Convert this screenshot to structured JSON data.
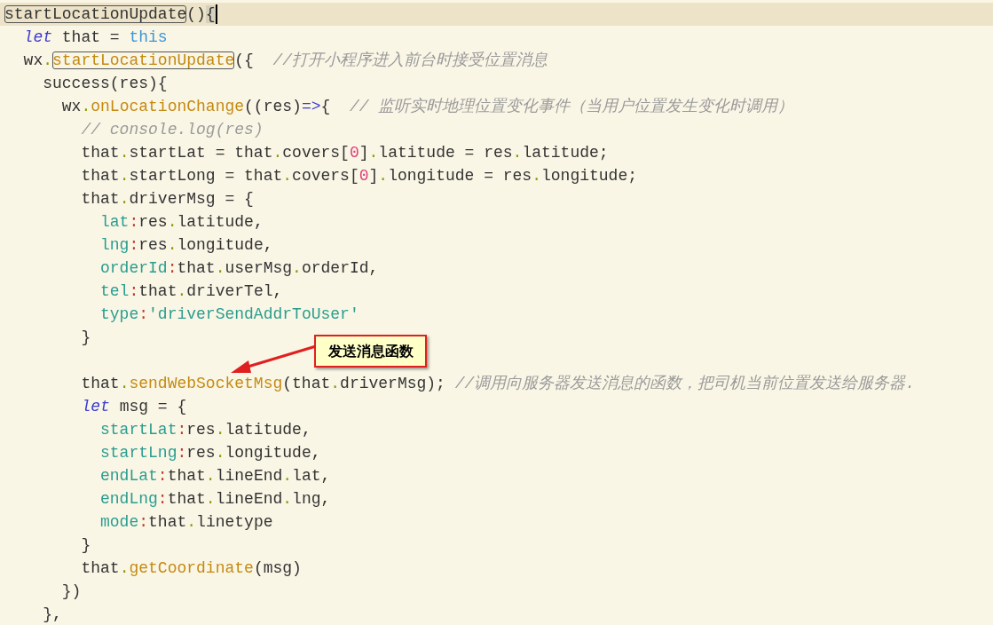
{
  "editor": {
    "lines": [
      {
        "current": true,
        "tokens": [
          {
            "text": "startLocationUpdate",
            "kind": "plain",
            "boxed": true
          },
          {
            "text": "()",
            "kind": "plain"
          },
          {
            "text": "{",
            "kind": "plain",
            "shaded": true
          }
        ]
      },
      {
        "current": false,
        "tokens": [
          {
            "text": "  let",
            "kind": "keyword"
          },
          {
            "text": " that = ",
            "kind": "plain"
          },
          {
            "text": "this",
            "kind": "this"
          }
        ]
      },
      {
        "current": false,
        "tokens": [
          {
            "text": "  wx",
            "kind": "plain"
          },
          {
            "text": ".",
            "kind": "dot"
          },
          {
            "text": "startLocationUpdate",
            "kind": "func",
            "boxed": true
          },
          {
            "text": "({  ",
            "kind": "plain"
          },
          {
            "text": "//打开小程序进入前台时接受位置消息",
            "kind": "comment"
          }
        ]
      },
      {
        "current": false,
        "tokens": [
          {
            "text": "    success(res){",
            "kind": "plain"
          }
        ]
      },
      {
        "current": false,
        "tokens": [
          {
            "text": "      wx",
            "kind": "plain"
          },
          {
            "text": ".",
            "kind": "dot"
          },
          {
            "text": "onLocationChange",
            "kind": "func"
          },
          {
            "text": "((res)",
            "kind": "plain"
          },
          {
            "text": "=>",
            "kind": "operator"
          },
          {
            "text": "{  ",
            "kind": "plain"
          },
          {
            "text": "// 监听实时地理位置变化事件（当用户位置发生变化时调用）",
            "kind": "comment"
          }
        ]
      },
      {
        "current": false,
        "tokens": [
          {
            "text": "        // console.log(res)",
            "kind": "comment"
          }
        ]
      },
      {
        "current": false,
        "tokens": [
          {
            "text": "        that",
            "kind": "plain"
          },
          {
            "text": ".",
            "kind": "dot"
          },
          {
            "text": "startLat = that",
            "kind": "plain"
          },
          {
            "text": ".",
            "kind": "dot"
          },
          {
            "text": "covers[",
            "kind": "plain"
          },
          {
            "text": "0",
            "kind": "number"
          },
          {
            "text": "]",
            "kind": "plain"
          },
          {
            "text": ".",
            "kind": "dot"
          },
          {
            "text": "latitude = res",
            "kind": "plain"
          },
          {
            "text": ".",
            "kind": "dot"
          },
          {
            "text": "latitude;",
            "kind": "plain"
          }
        ]
      },
      {
        "current": false,
        "tokens": [
          {
            "text": "        that",
            "kind": "plain"
          },
          {
            "text": ".",
            "kind": "dot"
          },
          {
            "text": "startLong = that",
            "kind": "plain"
          },
          {
            "text": ".",
            "kind": "dot"
          },
          {
            "text": "covers[",
            "kind": "plain"
          },
          {
            "text": "0",
            "kind": "number"
          },
          {
            "text": "]",
            "kind": "plain"
          },
          {
            "text": ".",
            "kind": "dot"
          },
          {
            "text": "longitude = res",
            "kind": "plain"
          },
          {
            "text": ".",
            "kind": "dot"
          },
          {
            "text": "longitude;",
            "kind": "plain"
          }
        ]
      },
      {
        "current": false,
        "tokens": [
          {
            "text": "        that",
            "kind": "plain"
          },
          {
            "text": ".",
            "kind": "dot"
          },
          {
            "text": "driverMsg = {",
            "kind": "plain"
          }
        ]
      },
      {
        "current": false,
        "tokens": [
          {
            "text": "          lat",
            "kind": "property"
          },
          {
            "text": ":",
            "kind": "colon"
          },
          {
            "text": "res",
            "kind": "plain"
          },
          {
            "text": ".",
            "kind": "dot"
          },
          {
            "text": "latitude,",
            "kind": "plain"
          }
        ]
      },
      {
        "current": false,
        "tokens": [
          {
            "text": "          lng",
            "kind": "property"
          },
          {
            "text": ":",
            "kind": "colon"
          },
          {
            "text": "res",
            "kind": "plain"
          },
          {
            "text": ".",
            "kind": "dot"
          },
          {
            "text": "longitude,",
            "kind": "plain"
          }
        ]
      },
      {
        "current": false,
        "tokens": [
          {
            "text": "          orderId",
            "kind": "property"
          },
          {
            "text": ":",
            "kind": "colon"
          },
          {
            "text": "that",
            "kind": "plain"
          },
          {
            "text": ".",
            "kind": "dot"
          },
          {
            "text": "userMsg",
            "kind": "plain"
          },
          {
            "text": ".",
            "kind": "dot"
          },
          {
            "text": "orderId,",
            "kind": "plain"
          }
        ]
      },
      {
        "current": false,
        "tokens": [
          {
            "text": "          tel",
            "kind": "property"
          },
          {
            "text": ":",
            "kind": "colon"
          },
          {
            "text": "that",
            "kind": "plain"
          },
          {
            "text": ".",
            "kind": "dot"
          },
          {
            "text": "driverTel,",
            "kind": "plain"
          }
        ]
      },
      {
        "current": false,
        "tokens": [
          {
            "text": "          type",
            "kind": "property"
          },
          {
            "text": ":",
            "kind": "colon"
          },
          {
            "text": "'driverSendAddrToUser'",
            "kind": "string"
          }
        ]
      },
      {
        "current": false,
        "tokens": [
          {
            "text": "        }",
            "kind": "plain"
          }
        ]
      },
      {
        "current": false,
        "blank_line_before": true,
        "tokens": [
          {
            "text": "        that",
            "kind": "plain"
          },
          {
            "text": ".",
            "kind": "dot"
          },
          {
            "text": "sendWebSocketMsg",
            "kind": "func"
          },
          {
            "text": "(that",
            "kind": "plain"
          },
          {
            "text": ".",
            "kind": "dot"
          },
          {
            "text": "driverMsg); ",
            "kind": "plain"
          },
          {
            "text": "//调用向服务器发送消息的函数，把司机当前位置发送给服务器.",
            "kind": "comment"
          }
        ]
      },
      {
        "current": false,
        "tokens": [
          {
            "text": "        let",
            "kind": "keyword"
          },
          {
            "text": " msg = {",
            "kind": "plain"
          }
        ]
      },
      {
        "current": false,
        "tokens": [
          {
            "text": "          startLat",
            "kind": "property"
          },
          {
            "text": ":",
            "kind": "colon"
          },
          {
            "text": "res",
            "kind": "plain"
          },
          {
            "text": ".",
            "kind": "dot"
          },
          {
            "text": "latitude,",
            "kind": "plain"
          }
        ]
      },
      {
        "current": false,
        "tokens": [
          {
            "text": "          startLng",
            "kind": "property"
          },
          {
            "text": ":",
            "kind": "colon"
          },
          {
            "text": "res",
            "kind": "plain"
          },
          {
            "text": ".",
            "kind": "dot"
          },
          {
            "text": "longitude,",
            "kind": "plain"
          }
        ]
      },
      {
        "current": false,
        "tokens": [
          {
            "text": "          endLat",
            "kind": "property"
          },
          {
            "text": ":",
            "kind": "colon"
          },
          {
            "text": "that",
            "kind": "plain"
          },
          {
            "text": ".",
            "kind": "dot"
          },
          {
            "text": "lineEnd",
            "kind": "plain"
          },
          {
            "text": ".",
            "kind": "dot"
          },
          {
            "text": "lat,",
            "kind": "plain"
          }
        ]
      },
      {
        "current": false,
        "tokens": [
          {
            "text": "          endLng",
            "kind": "property"
          },
          {
            "text": ":",
            "kind": "colon"
          },
          {
            "text": "that",
            "kind": "plain"
          },
          {
            "text": ".",
            "kind": "dot"
          },
          {
            "text": "lineEnd",
            "kind": "plain"
          },
          {
            "text": ".",
            "kind": "dot"
          },
          {
            "text": "lng,",
            "kind": "plain"
          }
        ]
      },
      {
        "current": false,
        "tokens": [
          {
            "text": "          mode",
            "kind": "property"
          },
          {
            "text": ":",
            "kind": "colon"
          },
          {
            "text": "that",
            "kind": "plain"
          },
          {
            "text": ".",
            "kind": "dot"
          },
          {
            "text": "linetype",
            "kind": "plain"
          }
        ]
      },
      {
        "current": false,
        "tokens": [
          {
            "text": "        }",
            "kind": "plain"
          }
        ]
      },
      {
        "current": false,
        "tokens": [
          {
            "text": "        that",
            "kind": "plain"
          },
          {
            "text": ".",
            "kind": "dot"
          },
          {
            "text": "getCoordinate",
            "kind": "func"
          },
          {
            "text": "(msg)",
            "kind": "plain"
          }
        ]
      },
      {
        "current": false,
        "tokens": [
          {
            "text": "      })",
            "kind": "plain"
          }
        ]
      },
      {
        "current": false,
        "tokens": [
          {
            "text": "    },",
            "kind": "plain"
          }
        ]
      }
    ]
  },
  "callout": {
    "text": "发送消息函数"
  }
}
